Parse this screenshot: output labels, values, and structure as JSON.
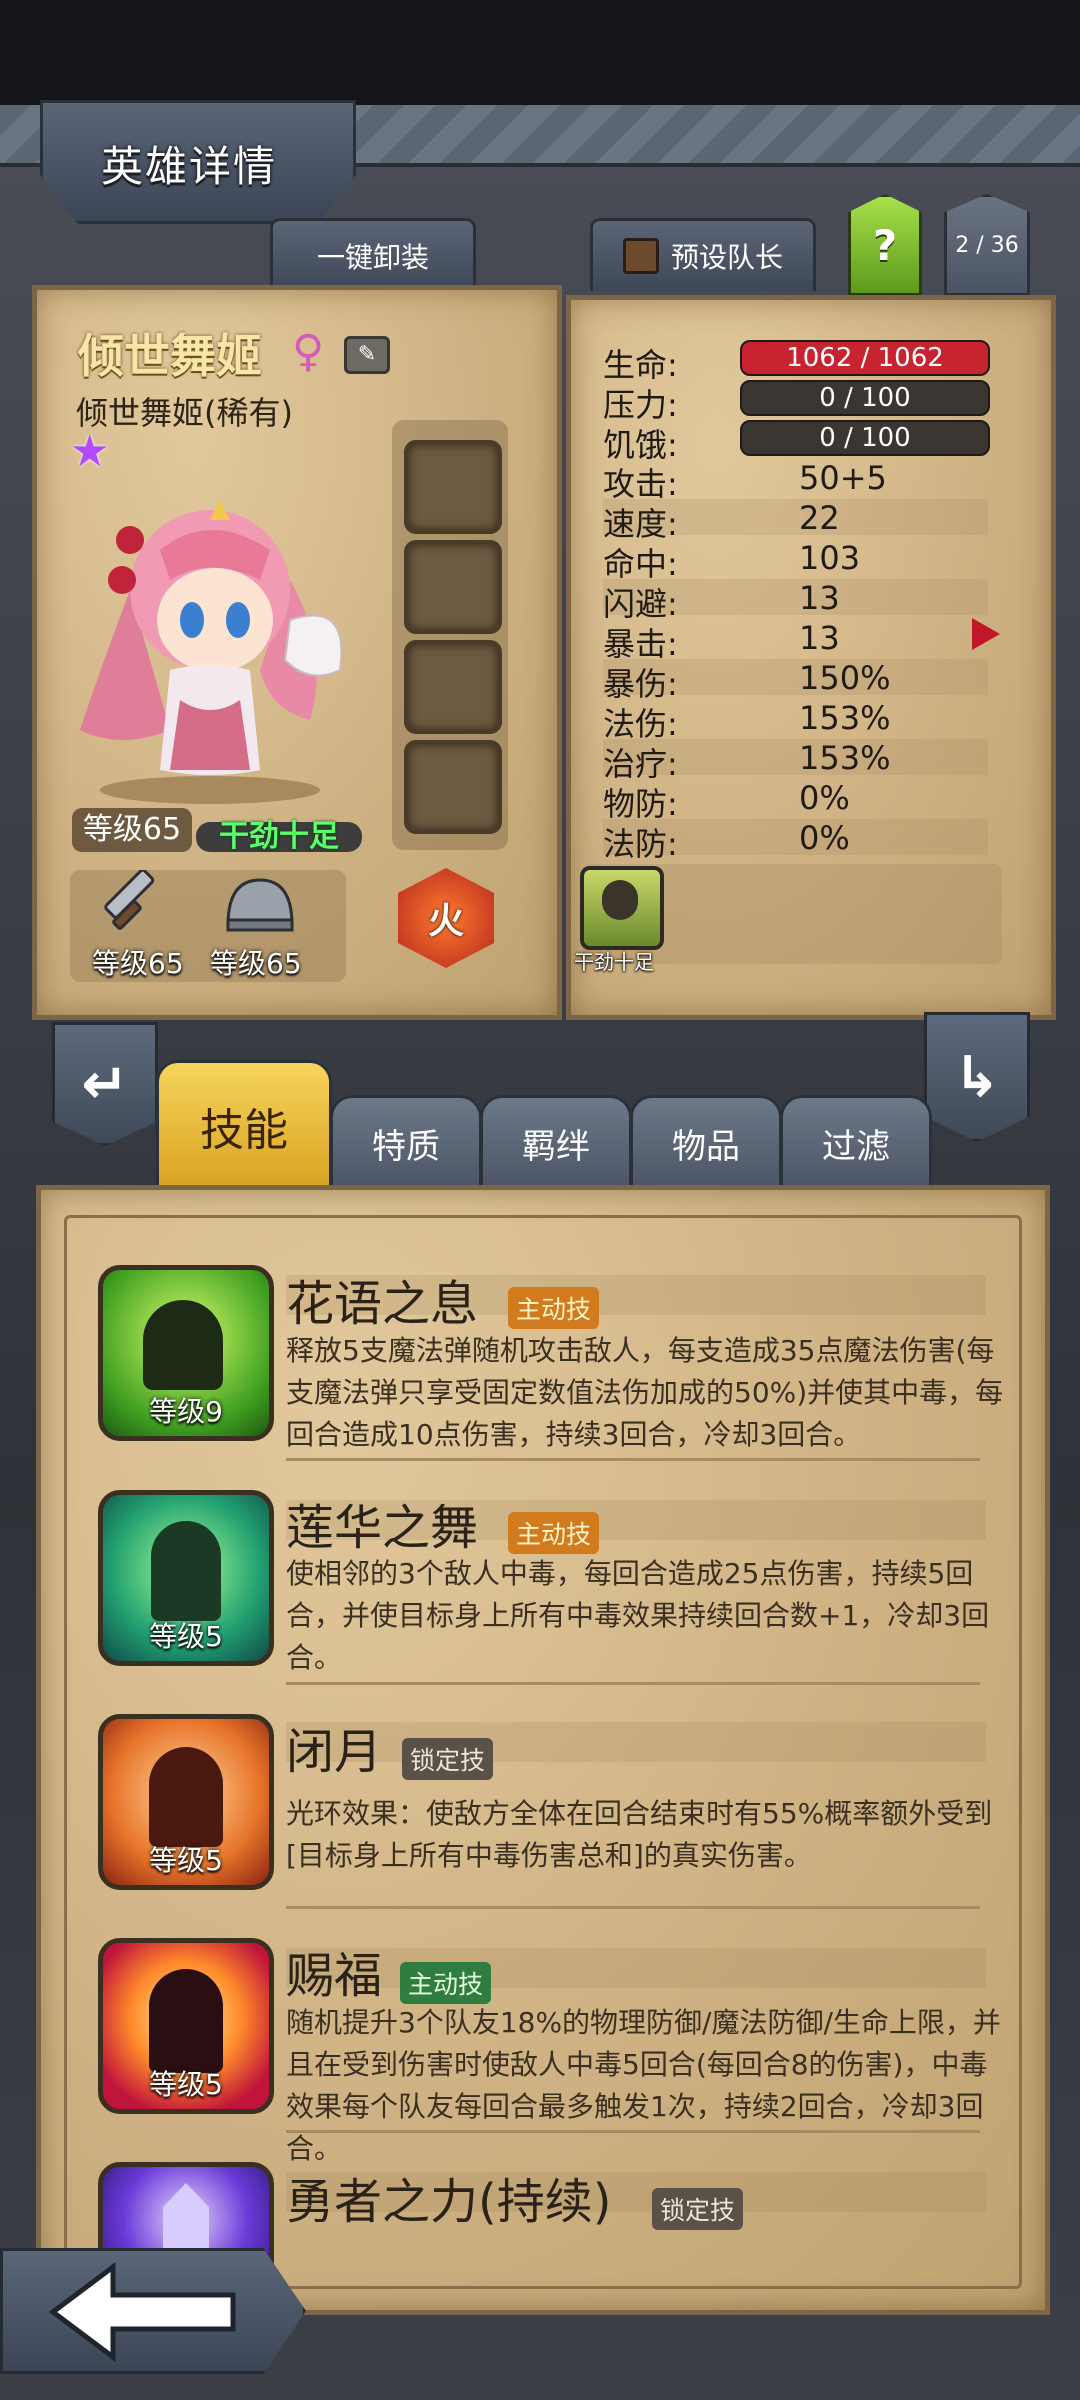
{
  "header": {
    "title": "英雄详情"
  },
  "top_buttons": {
    "unequip": "一键卸装",
    "preset_leader": "预设队长",
    "help": "?",
    "page_count": "2 / 36"
  },
  "hero": {
    "name": "倾世舞姬",
    "rarity_text": "倾世舞姬(稀有)",
    "gender_icon": "female-symbol-icon",
    "level": "等级65",
    "status": "干劲十足",
    "weapon_level": "等级65",
    "armor_level": "等级65",
    "element": "火"
  },
  "stats": {
    "hp": {
      "label": "生命:",
      "value": "1062 / 1062",
      "fraction": 1.0
    },
    "stress": {
      "label": "压力:",
      "value": "0 / 100",
      "fraction": 0
    },
    "hunger": {
      "label": "饥饿:",
      "value": "0 / 100",
      "fraction": 0
    },
    "rows": [
      {
        "label": "攻击:",
        "value": "50+5"
      },
      {
        "label": "速度:",
        "value": "22"
      },
      {
        "label": "命中:",
        "value": "103"
      },
      {
        "label": "闪避:",
        "value": "13"
      },
      {
        "label": "暴击:",
        "value": "13"
      },
      {
        "label": "暴伤:",
        "value": "150%"
      },
      {
        "label": "法伤:",
        "value": "153%"
      },
      {
        "label": "治疗:",
        "value": "153%"
      },
      {
        "label": "物防:",
        "value": "0%"
      },
      {
        "label": "法防:",
        "value": "0%"
      }
    ],
    "buff_label": "干劲十足"
  },
  "tabs": [
    {
      "label": "技能",
      "active": true
    },
    {
      "label": "特质"
    },
    {
      "label": "羁绊"
    },
    {
      "label": "物品"
    },
    {
      "label": "过滤"
    }
  ],
  "skills": [
    {
      "name": "花语之息",
      "tag": "主动技",
      "level": "等级9",
      "desc": "释放5支魔法弹随机攻击敌人，每支造成35点魔法伤害(每支魔法弹只享受固定数值法伤加成的50%)并使其中毒，每回合造成10点伤害，持续3回合，冷却3回合。"
    },
    {
      "name": "莲华之舞",
      "tag": "主动技",
      "level": "等级5",
      "desc": "使相邻的3个敌人中毒，每回合造成25点伤害，持续5回合，并使目标身上所有中毒效果持续回合数+1，冷却3回合。"
    },
    {
      "name": "闭月",
      "tag": "锁定技",
      "level": "等级5",
      "desc": "光环效果：使敌方全体在回合结束时有55%概率额外受到[目标身上所有中毒伤害总和]的真实伤害。"
    },
    {
      "name": "赐福",
      "tag": "主动技",
      "level": "等级5",
      "desc": "随机提升3个队友18%的物理防御/魔法防御/生命上限，并且在受到伤害时使敌人中毒5回合(每回合8的伤害)，中毒效果每个队友每回合最多触发1次，持续2回合，冷却3回合。"
    },
    {
      "name": "勇者之力(持续)",
      "tag": "锁定技",
      "level": ""
    }
  ],
  "colors": {
    "hp_bar": "#c8242f",
    "accent_gold": "#f2c94c",
    "parchment": "#d4b98c"
  }
}
